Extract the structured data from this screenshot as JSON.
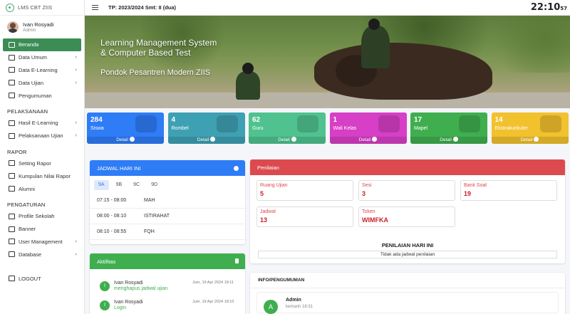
{
  "app": {
    "brand": "LMS CBT ZIIS"
  },
  "user": {
    "name": "Ivan Rosyadi",
    "role": "Admin"
  },
  "topbar": {
    "tp": "TP: 2023/2024 Smt: II (dua)",
    "clock_hm": "22:10",
    "clock_s": "57"
  },
  "sidebar": {
    "items": [
      {
        "label": "Beranda"
      },
      {
        "label": "Data Umum"
      },
      {
        "label": "Data E-Learning"
      },
      {
        "label": "Data Ujian"
      },
      {
        "label": "Pengumuman"
      }
    ],
    "sec_pelaksanaan": "PELAKSANAAN",
    "pelaksanaan": [
      {
        "label": "Hasil E-Learning"
      },
      {
        "label": "Pelaksanaan Ujian"
      }
    ],
    "sec_rapor": "RAPOR",
    "rapor": [
      {
        "label": "Setting Rapor"
      },
      {
        "label": "Kumpulan Nilai Rapor"
      },
      {
        "label": "Alumni"
      }
    ],
    "sec_pengaturan": "PENGATURAN",
    "pengaturan": [
      {
        "label": "Profile Sekolah"
      },
      {
        "label": "Banner"
      },
      {
        "label": "User Management"
      },
      {
        "label": "Database"
      }
    ],
    "logout": "LOGOUT"
  },
  "banner": {
    "title1": "Learning Management System",
    "title2": "& Computer Based Test",
    "subtitle": "Pondok Pesantren Modern ZIIS"
  },
  "boxes": [
    {
      "num": "284",
      "label": "Siswa",
      "footer": "Detail",
      "color": "#2e7cf6"
    },
    {
      "num": "4",
      "label": "Rombel",
      "footer": "Detail",
      "color": "#3ea0b3"
    },
    {
      "num": "62",
      "label": "Guru",
      "footer": "Detail",
      "color": "#4fc28f"
    },
    {
      "num": "1",
      "label": "Wali Kelas",
      "footer": "Detail",
      "color": "#d63fc6"
    },
    {
      "num": "17",
      "label": "Mapel",
      "footer": "Detail",
      "color": "#3fae4f"
    },
    {
      "num": "14",
      "label": "Ekstrakurikuler",
      "footer": "Detail",
      "color": "#f2c12e"
    }
  ],
  "jadwal": {
    "title": "JADWAL HARI INI",
    "tabs": [
      "9A",
      "9B",
      "9C",
      "9D"
    ],
    "rows": [
      {
        "time": "07:15 - 08:00",
        "mapel": "MAH"
      },
      {
        "time": "08:00 - 08:10",
        "mapel": "ISTIRAHAT"
      },
      {
        "time": "08:10 - 08:55",
        "mapel": "FQH"
      }
    ]
  },
  "aktifitas": {
    "title": "Aktifitas",
    "items": [
      {
        "initial": "I",
        "name": "Ivan Rosyadi",
        "action": "menghapus jadwal ujian",
        "time": "Jum, 19 Apr 2024 18:11"
      },
      {
        "initial": "I",
        "name": "Ivan Rosyadi",
        "action": "Login",
        "time": "Jum, 19 Apr 2024 18:10"
      }
    ]
  },
  "penilaian": {
    "title": "Penilaian",
    "stats": [
      {
        "label": "Ruang Ujian",
        "value": "5"
      },
      {
        "label": "Sesi",
        "value": "3"
      },
      {
        "label": "Bank Soal",
        "value": "19"
      },
      {
        "label": "Jadwal",
        "value": "13"
      },
      {
        "label": "Token",
        "value": "WIMFKA"
      }
    ],
    "today_title": "PENILAIAN HARI INI",
    "today_empty": "Tidak ada jadwal penilaian"
  },
  "info": {
    "title": "INFO/PENGUMUMAN",
    "post": {
      "initial": "A",
      "name": "Admin",
      "time": "kemarin 18:31"
    }
  }
}
